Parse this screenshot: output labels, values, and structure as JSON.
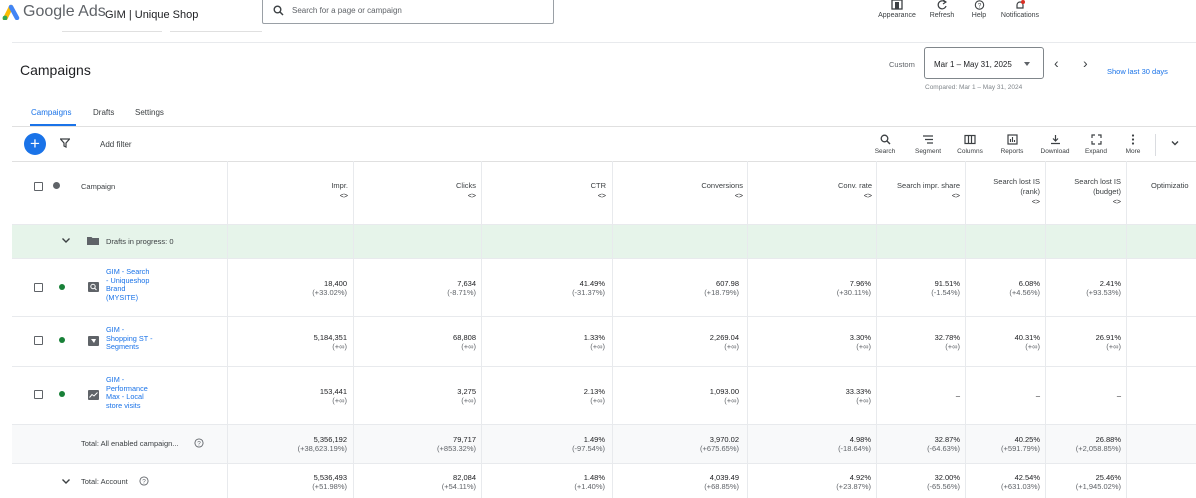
{
  "app": {
    "brand": "Google Ads",
    "account": "GIM | Unique Shop",
    "search_placeholder": "Search for a page or campaign"
  },
  "header_tools": [
    {
      "label": "Appearance",
      "icon": "appearance-icon"
    },
    {
      "label": "Refresh",
      "icon": "refresh-icon"
    },
    {
      "label": "Help",
      "icon": "help-icon"
    },
    {
      "label": "Notifications",
      "icon": "notifications-icon"
    }
  ],
  "page": {
    "title": "Campaigns",
    "date_label": "Custom",
    "date_range": "Mar 1 – May 31, 2025",
    "compared": "Compared: Mar 1 – May 31, 2024",
    "show_last": "Show last 30 days"
  },
  "tabs": [
    {
      "label": "Campaigns",
      "active": true
    },
    {
      "label": "Drafts"
    },
    {
      "label": "Settings"
    }
  ],
  "toolbar": {
    "add_filter": "Add filter",
    "items": [
      {
        "label": "Search",
        "icon": "search-icon"
      },
      {
        "label": "Segment",
        "icon": "segment-icon"
      },
      {
        "label": "Columns",
        "icon": "columns-icon"
      },
      {
        "label": "Reports",
        "icon": "reports-icon"
      },
      {
        "label": "Download",
        "icon": "download-icon"
      },
      {
        "label": "Expand",
        "icon": "expand-icon"
      },
      {
        "label": "More",
        "icon": "more-icon"
      }
    ]
  },
  "table": {
    "campaign_header": "Campaign",
    "columns": [
      {
        "l1": "Impr.",
        "l2": "",
        "l3": "<>"
      },
      {
        "l1": "Clicks",
        "l2": "",
        "l3": "<>"
      },
      {
        "l1": "CTR",
        "l2": "",
        "l3": "<>"
      },
      {
        "l1": "Conversions",
        "l2": "",
        "l3": "<>"
      },
      {
        "l1": "Conv. rate",
        "l2": "",
        "l3": "<>"
      },
      {
        "l1": "Search impr. share",
        "l2": "",
        "l3": "<>"
      },
      {
        "l1": "Search lost IS",
        "l2": "(rank)",
        "l3": "<>"
      },
      {
        "l1": "Search lost IS",
        "l2": "(budget)",
        "l3": "<>"
      },
      {
        "l1": "Optimizatio",
        "l2": "",
        "l3": ""
      }
    ],
    "drafts_label": "Drafts in progress: 0",
    "rows": [
      {
        "name": [
          "GIM - Search",
          "- Uniqueshop",
          "Brand",
          "(MYSITE)"
        ],
        "type_icon": "search-campaign-icon",
        "cells": [
          [
            "18,400",
            "(+33.02%)"
          ],
          [
            "7,634",
            "(-8.71%)"
          ],
          [
            "41.49%",
            "(-31.37%)"
          ],
          [
            "607.98",
            "(+18.79%)"
          ],
          [
            "7.96%",
            "(+30.11%)"
          ],
          [
            "91.51%",
            "(-1.54%)"
          ],
          [
            "6.08%",
            "(+4.56%)"
          ],
          [
            "2.41%",
            "(+93.53%)"
          ]
        ]
      },
      {
        "name": [
          "GIM -",
          "Shopping ST -",
          "Segments"
        ],
        "type_icon": "shopping-campaign-icon",
        "cells": [
          [
            "5,184,351",
            "(+∞)"
          ],
          [
            "68,808",
            "(+∞)"
          ],
          [
            "1.33%",
            "(+∞)"
          ],
          [
            "2,269.04",
            "(+∞)"
          ],
          [
            "3.30%",
            "(+∞)"
          ],
          [
            "32.78%",
            "(+∞)"
          ],
          [
            "40.31%",
            "(+∞)"
          ],
          [
            "26.91%",
            "(+∞)"
          ]
        ]
      },
      {
        "name": [
          "GIM -",
          "Performance",
          "Max - Local",
          "store visits"
        ],
        "type_icon": "performance-max-icon",
        "cells": [
          [
            "153,441",
            "(+∞)"
          ],
          [
            "3,275",
            "(+∞)"
          ],
          [
            "2.13%",
            "(+∞)"
          ],
          [
            "1,093.00",
            "(+∞)"
          ],
          [
            "33.33%",
            "(+∞)"
          ],
          [
            "–",
            ""
          ],
          [
            "–",
            ""
          ],
          [
            "–",
            ""
          ]
        ]
      }
    ],
    "totals": [
      {
        "label": "Total: All enabled campaign...",
        "cells": [
          [
            "5,356,192",
            "(+38,623.19%)"
          ],
          [
            "79,717",
            "(+853.32%)"
          ],
          [
            "1.49%",
            "(-97.54%)"
          ],
          [
            "3,970.02",
            "(+675.65%)"
          ],
          [
            "4.98%",
            "(-18.64%)"
          ],
          [
            "32.87%",
            "(-64.63%)"
          ],
          [
            "40.25%",
            "(+591.79%)"
          ],
          [
            "26.88%",
            "(+2,058.85%)"
          ]
        ]
      },
      {
        "label": "Total: Account",
        "cells": [
          [
            "5,536,493",
            "(+51.98%)"
          ],
          [
            "82,084",
            "(+54.11%)"
          ],
          [
            "1.48%",
            "(+1.40%)"
          ],
          [
            "4,039.49",
            "(+68.85%)"
          ],
          [
            "4.92%",
            "(+23.87%)"
          ],
          [
            "32.00%",
            "(-65.56%)"
          ],
          [
            "42.54%",
            "(+631.03%)"
          ],
          [
            "25.46%",
            "(+1,945.02%)"
          ]
        ]
      }
    ]
  },
  "colors": {
    "accent": "#1a73e8",
    "enabled": "#188038",
    "drafts_bg": "#e6f4ea"
  }
}
